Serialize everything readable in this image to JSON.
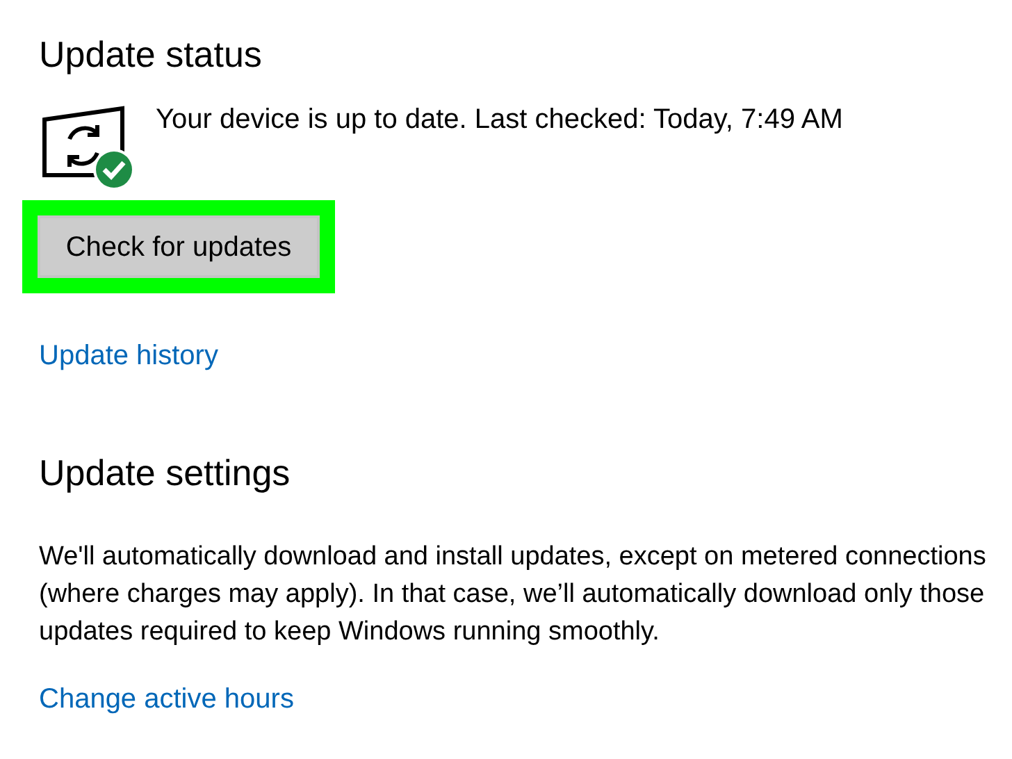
{
  "update_status": {
    "title": "Update status",
    "message": "Your device is up to date. Last checked: Today, 7:49 AM",
    "check_button": {
      "label": "Check for updates",
      "highlighted": true
    },
    "history_link": "Update history"
  },
  "update_settings": {
    "title": "Update settings",
    "description": "We'll automatically download and install updates, except on metered connections (where charges may apply). In that case, we’ll automatically download only those updates required to keep Windows running smoothly.",
    "active_hours_link": "Change active hours"
  }
}
